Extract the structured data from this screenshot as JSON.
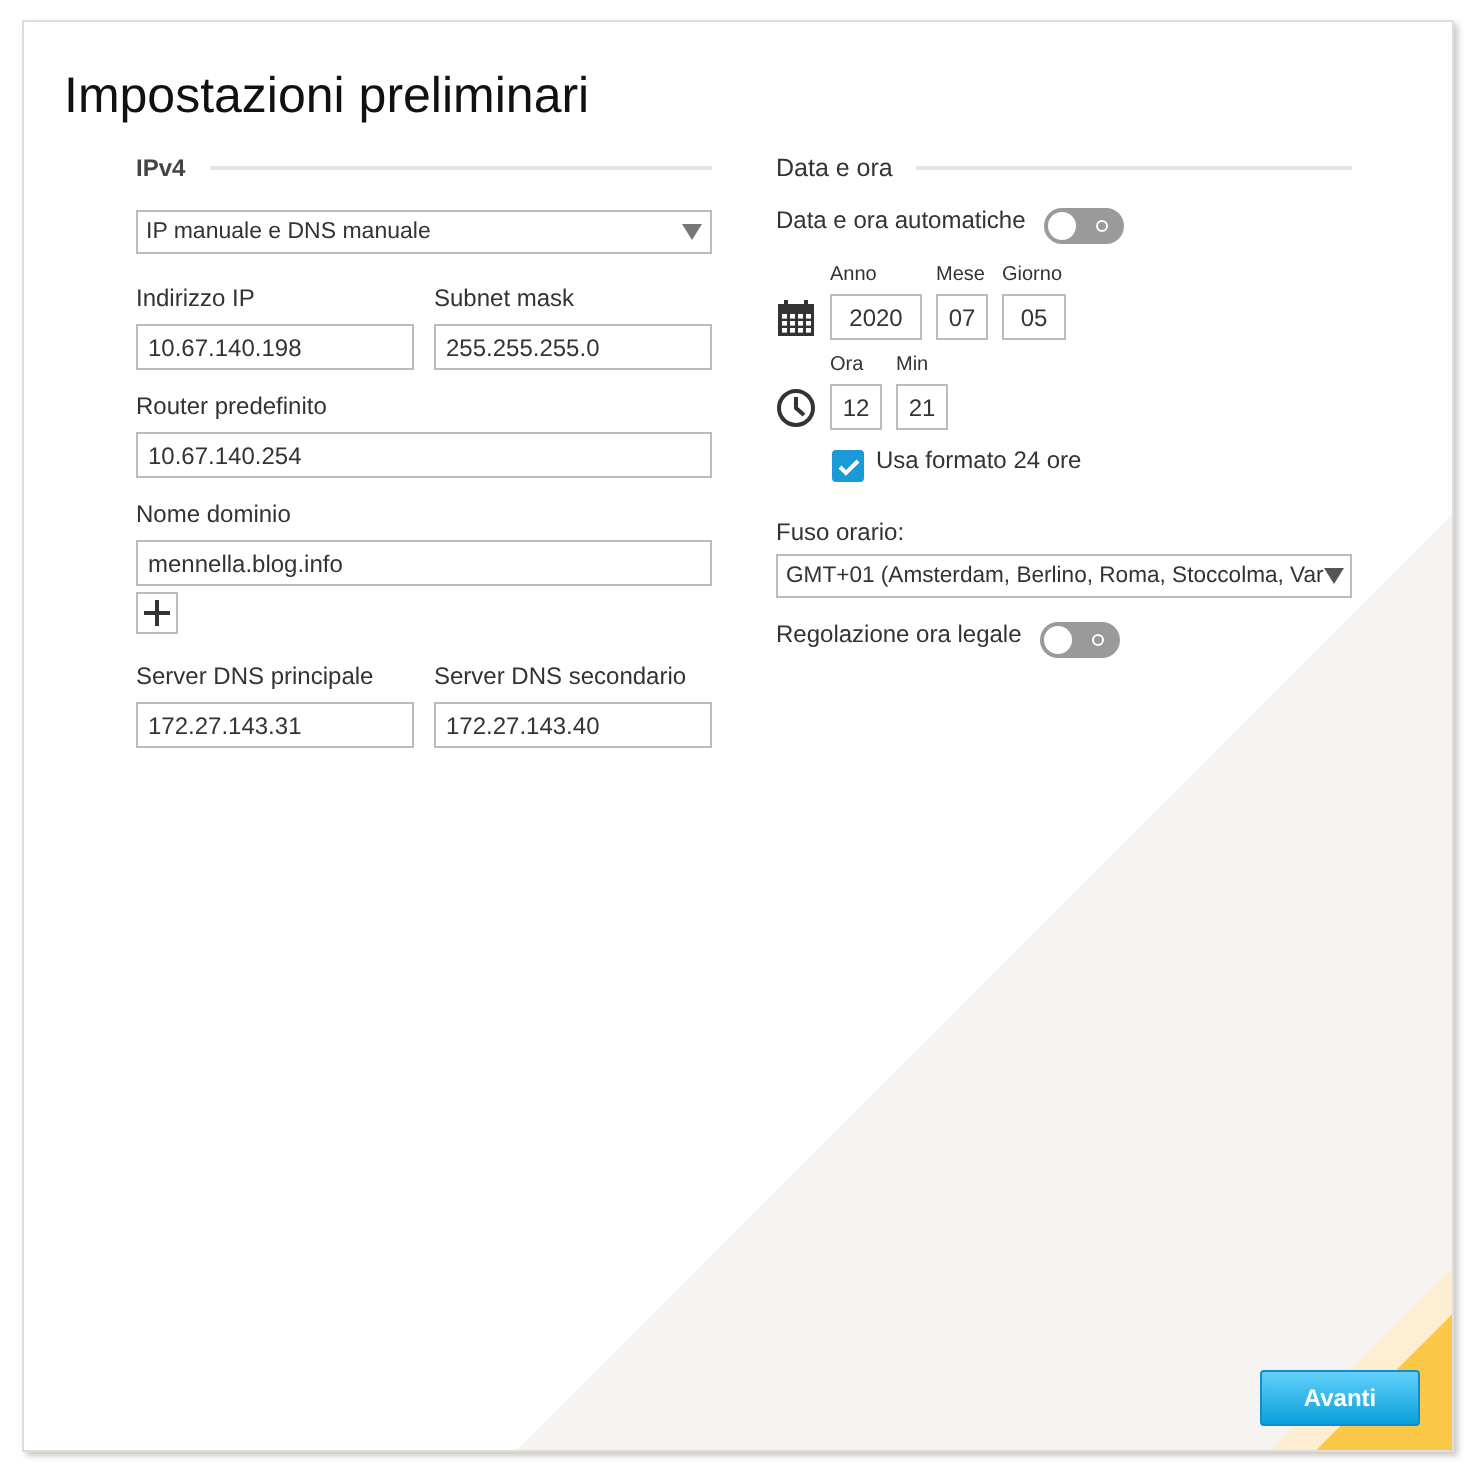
{
  "title": "Impostazioni preliminari",
  "ipv4": {
    "heading": "IPv4",
    "mode": {
      "value": "IP manuale e DNS manuale"
    },
    "rows": [
      [
        {
          "label": "Indirizzo IP",
          "value": "10.67.140.198"
        },
        {
          "label": "Subnet mask",
          "value": "255.255.255.0"
        }
      ],
      [
        {
          "label": "Router predefinito",
          "value": "10.67.140.254"
        }
      ],
      [
        {
          "label": "Nome dominio",
          "value": "mennella.blog.info",
          "addable": true
        }
      ],
      [
        {
          "label": "Server DNS principale",
          "value": "172.27.143.31"
        },
        {
          "label": "Server DNS secondario",
          "value": "172.27.143.40"
        }
      ]
    ]
  },
  "datetime": {
    "heading": "Data e ora",
    "auto": {
      "label": "Data e ora automatiche",
      "on": false
    },
    "date": [
      {
        "label": "Anno",
        "value": "2020"
      },
      {
        "label": "Mese",
        "value": "07"
      },
      {
        "label": "Giorno",
        "value": "05"
      }
    ],
    "time": [
      {
        "label": "Ora",
        "value": "12"
      },
      {
        "label": "Min",
        "value": "21"
      }
    ],
    "format24": {
      "label": "Usa formato 24 ore",
      "checked": true
    },
    "timezone": {
      "label": "Fuso orario:",
      "value": "GMT+01 (Amsterdam, Berlino, Roma, Stoccolma, Var"
    },
    "dst": {
      "label": "Regolazione ora legale",
      "on": false
    }
  },
  "next_button": "Avanti"
}
